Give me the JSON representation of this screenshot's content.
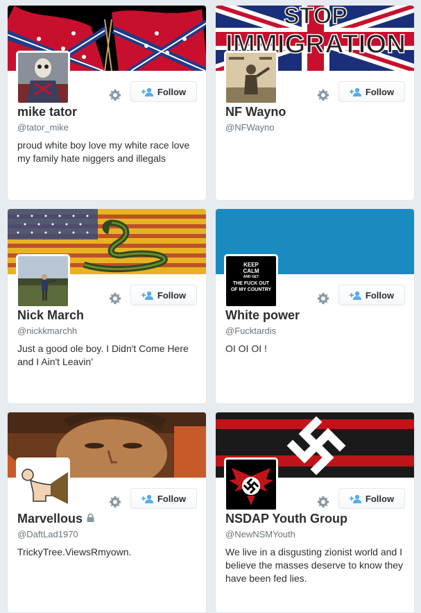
{
  "cards": [
    {
      "name": "mike tator",
      "handle": "@tator_mike",
      "bio": "proud white boy love my white race love my family hate niggers and illegals",
      "follow_label": "Follow",
      "avatar_icon": "skeleton-warrior-avatar",
      "banner_description": "confederate-flag-banner"
    },
    {
      "name": "NF Wayno",
      "handle": "@NFWayno",
      "bio": "",
      "follow_label": "Follow",
      "banner_text_top": "STOP",
      "banner_text_bottom": "IMMIGRATION",
      "avatar_icon": "historical-photo-avatar"
    },
    {
      "name": "Nick March",
      "handle": "@nickkmarchh",
      "bio": "Just a good ole boy. I Didn't Come Here and I Ain't Leavin'",
      "follow_label": "Follow",
      "avatar_icon": "field-photo-avatar",
      "banner_description": "flag-with-snake-banner"
    },
    {
      "name": "White power",
      "handle": "@Fucktardis",
      "bio": "OI OI OI !",
      "follow_label": "Follow",
      "avatar_lines": [
        "KEEP",
        "CALM",
        "AND GET",
        "THE FUCK OUT",
        "OF MY COUNTRY"
      ],
      "banner_color": "#1a8bc0"
    },
    {
      "name": "Marvellous",
      "handle": "@DaftLad1970",
      "bio": "TrickyTree.ViewsRmyown.",
      "follow_label": "Follow",
      "protected": true,
      "avatar_icon": "cartoon-figure-avatar",
      "banner_description": "face-photo-banner"
    },
    {
      "name": "NSDAP Youth Group",
      "handle": "@NewNSMYouth",
      "bio": "We live in a disgusting zionist world and I believe the masses deserve to know they have been fed lies.",
      "follow_label": "Follow",
      "avatar_icon": "eagle-emblem-avatar",
      "banner_description": "red-black-flag-banner"
    }
  ],
  "colors": {
    "page_bg": "#e6ecf0",
    "follow_icon": "#55acee",
    "name_text": "#292f33",
    "handle_text": "#66757f"
  }
}
